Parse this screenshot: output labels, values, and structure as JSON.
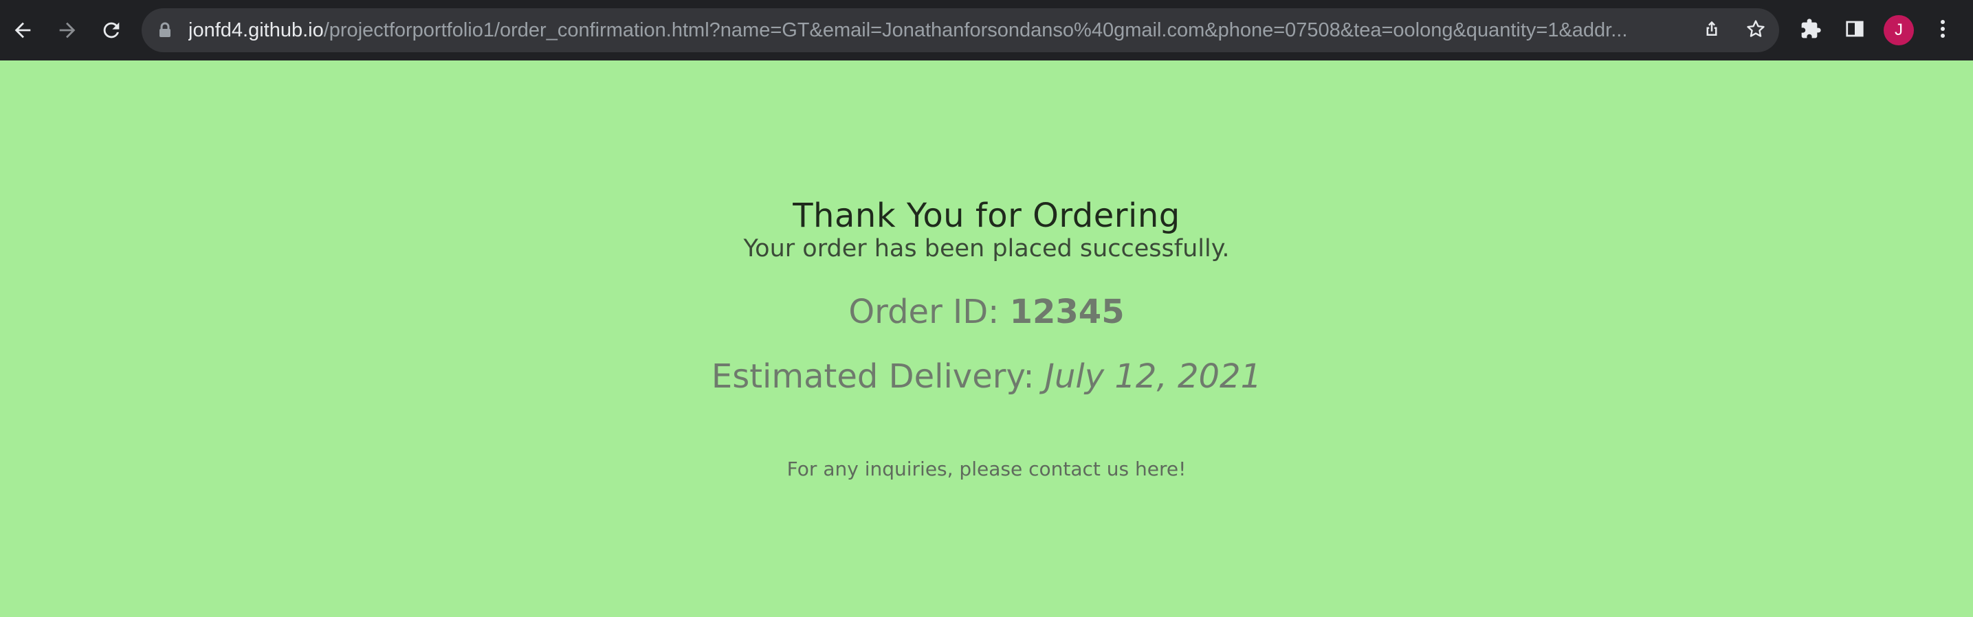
{
  "browser": {
    "url_host": "jonfd4.github.io",
    "url_rest": "/projectforportfolio1/order_confirmation.html?name=GT&email=Jonathanforsondanso%40gmail.com&phone=07508&tea=oolong&quantity=1&addr...",
    "profile_initial": "J",
    "icons": [
      "back-arrow-icon",
      "forward-arrow-icon",
      "reload-icon",
      "lock-icon",
      "share-icon",
      "star-icon",
      "extensions-puzzle-icon",
      "side-panel-icon",
      "more-vert-icon"
    ],
    "colors": {
      "toolbar": "#202124",
      "omnibox": "#35363a",
      "avatar": "#c2185b"
    }
  },
  "page": {
    "background": "#a6ec97",
    "title": "Thank You for Ordering",
    "subtitle": "Your order has been placed successfully.",
    "order_label": "Order ID: ",
    "order_id": "12345",
    "delivery_label": "Estimated Delivery: ",
    "delivery_date": "July 12, 2021",
    "inquiry_text": "For any inquiries, please contact us here!"
  }
}
